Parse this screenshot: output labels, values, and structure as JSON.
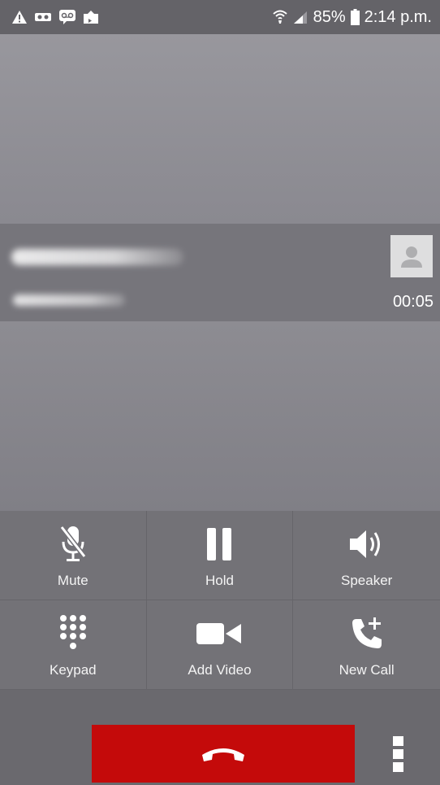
{
  "status_bar": {
    "icons_left": [
      "warning-icon",
      "voicemail-tape-icon",
      "voicemail-icon",
      "photo-upload-icon"
    ],
    "battery": "85%",
    "time": "2:14 p.m."
  },
  "caller": {
    "timer": "00:05"
  },
  "controls": [
    {
      "label": "Mute",
      "icon": "mic-off-icon"
    },
    {
      "label": "Hold",
      "icon": "pause-icon"
    },
    {
      "label": "Speaker",
      "icon": "speaker-icon"
    },
    {
      "label": "Keypad",
      "icon": "keypad-icon"
    },
    {
      "label": "Add Video",
      "icon": "video-icon"
    },
    {
      "label": "New Call",
      "icon": "add-call-icon"
    }
  ],
  "colors": {
    "end_call": "#c40a0a"
  }
}
